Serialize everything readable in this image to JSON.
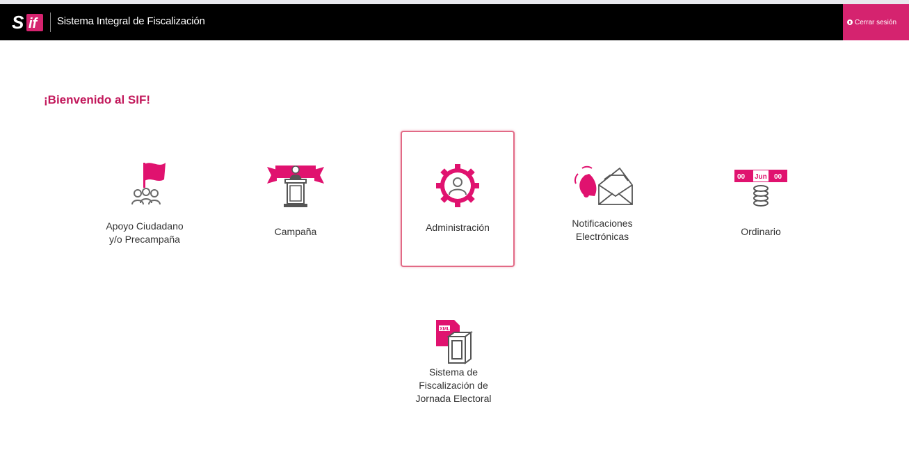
{
  "header": {
    "app_title": "Sistema Integral de Fiscalización",
    "logout_label": "Cerrar sesión",
    "brand_color": "#d5236f",
    "logo_icon": "sif-logo"
  },
  "welcome": {
    "text": "¡Bienvenido al SIF!"
  },
  "modules": [
    {
      "line1": "Apoyo Ciudadano",
      "line2": "y/o Precampaña",
      "icon": "flag-people-icon"
    },
    {
      "line1": "Campaña",
      "line2": "",
      "icon": "podium-banner-icon"
    },
    {
      "line1": "Administración",
      "line2": "",
      "icon": "user-gear-icon",
      "selected": true
    },
    {
      "line1": "Notificaciones",
      "line2": "Electrónicas",
      "icon": "bell-envelope-icon"
    },
    {
      "line1": "Ordinario",
      "line2": "",
      "icon": "calendar-coins-icon",
      "calendar_text": "00 Jun 00"
    },
    {
      "line1": "Sistema de",
      "line2": "Fiscalización de",
      "line3": "Jornada Electoral",
      "icon": "xml-ballot-box-icon",
      "xml_text": "XML"
    }
  ]
}
